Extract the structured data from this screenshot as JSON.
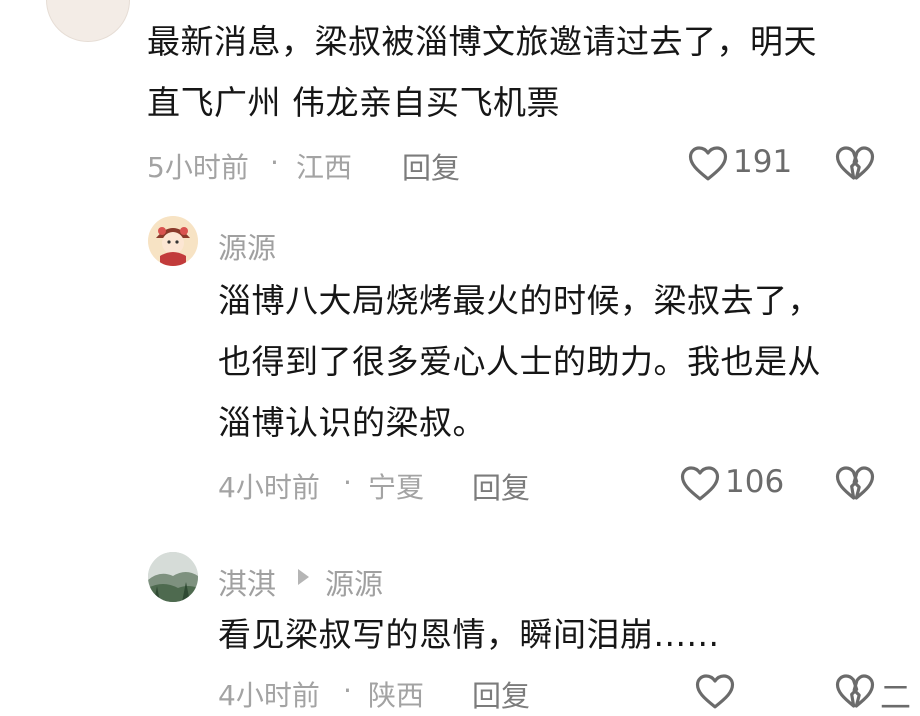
{
  "comments": [
    {
      "text_lines": [
        "最新消息，梁叔被淄博文旅邀请过去了，明天",
        "直飞广州 伟龙亲自买飞机票"
      ],
      "time": "5小时前",
      "location": "江西",
      "reply_label": "回复",
      "likes": "191"
    },
    {
      "username": "源源",
      "text_lines": [
        "淄博八大局烧烤最火的时候，梁叔去了，",
        "也得到了很多爱心人士的助力。我也是从",
        "淄博认识的梁叔。"
      ],
      "time": "4小时前",
      "location": "宁夏",
      "reply_label": "回复",
      "likes": "106"
    },
    {
      "username": "淇淇",
      "reply_to": "源源",
      "text_lines": [
        "看见梁叔写的恩情，瞬间泪崩......"
      ],
      "time": "4小时前",
      "location": "陕西",
      "reply_label": "回复",
      "likes": "二"
    }
  ],
  "separator": "·",
  "colors": {
    "text": "#161616",
    "meta": "#a3a3a3",
    "icon": "#6b6b6b"
  }
}
